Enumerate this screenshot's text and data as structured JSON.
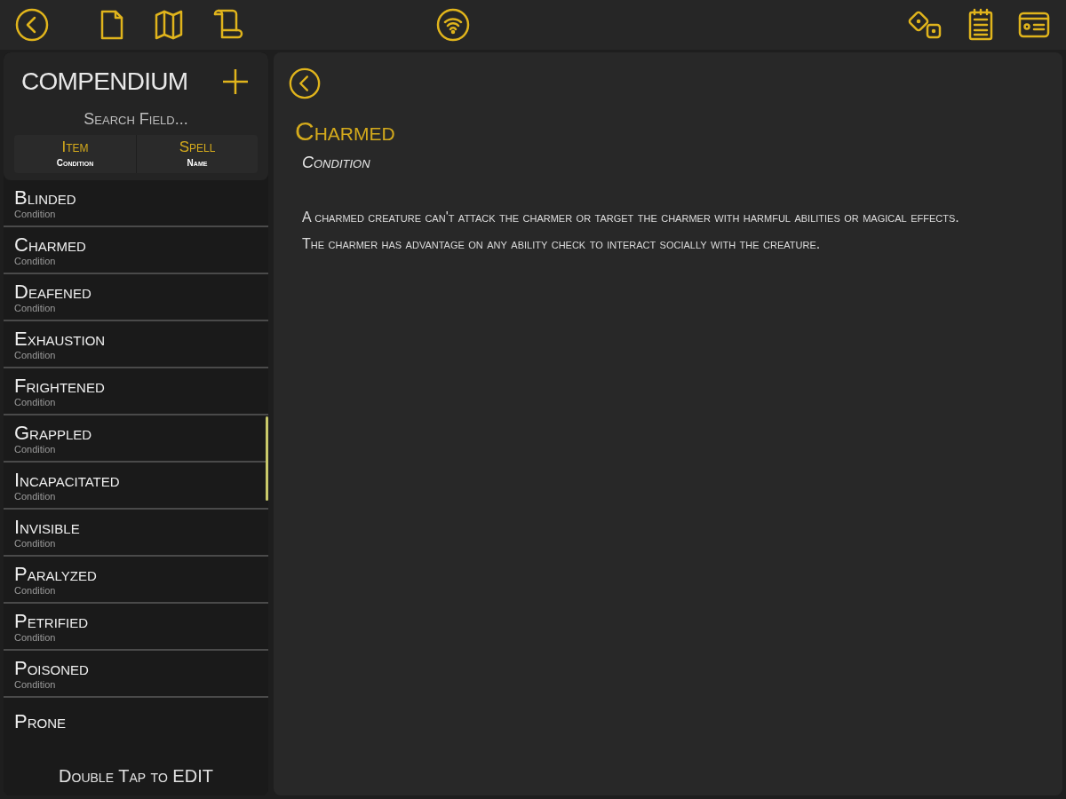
{
  "sidebar": {
    "title": "COMPENDIUM",
    "search": {
      "placeholder": "Search Field..."
    },
    "sort_options": [
      {
        "label": "Item",
        "sublabel": "Condition",
        "selected": false
      },
      {
        "label": "Spell",
        "sublabel": "Name",
        "selected": false
      }
    ],
    "items": [
      {
        "name": "Blinded",
        "type": "Condition",
        "selected": false
      },
      {
        "name": "Charmed",
        "type": "Condition",
        "selected": false
      },
      {
        "name": "Deafened",
        "type": "Condition",
        "selected": false
      },
      {
        "name": "Exhaustion",
        "type": "Condition",
        "selected": false
      },
      {
        "name": "Frightened",
        "type": "Condition",
        "selected": false
      },
      {
        "name": "Grappled",
        "type": "Condition",
        "selected": false
      },
      {
        "name": "Incapacitated",
        "type": "Condition",
        "selected": false
      },
      {
        "name": "Invisible",
        "type": "Condition",
        "selected": false
      },
      {
        "name": "Paralyzed",
        "type": "Condition",
        "selected": false
      },
      {
        "name": "Petrified",
        "type": "Condition",
        "selected": false
      },
      {
        "name": "Poisoned",
        "type": "Condition",
        "selected": false
      },
      {
        "name": "Prone"
      }
    ],
    "footer": "Double Tap to EDIT"
  },
  "detail": {
    "title": "Charmed",
    "subtitle": "Condition",
    "paragraphs": [
      "A charmed creature can't attack the charmer or target the charmer with harmful abilities or magical effects.",
      "The charmer has advantage on any ability check to interact socially with the creature."
    ]
  }
}
